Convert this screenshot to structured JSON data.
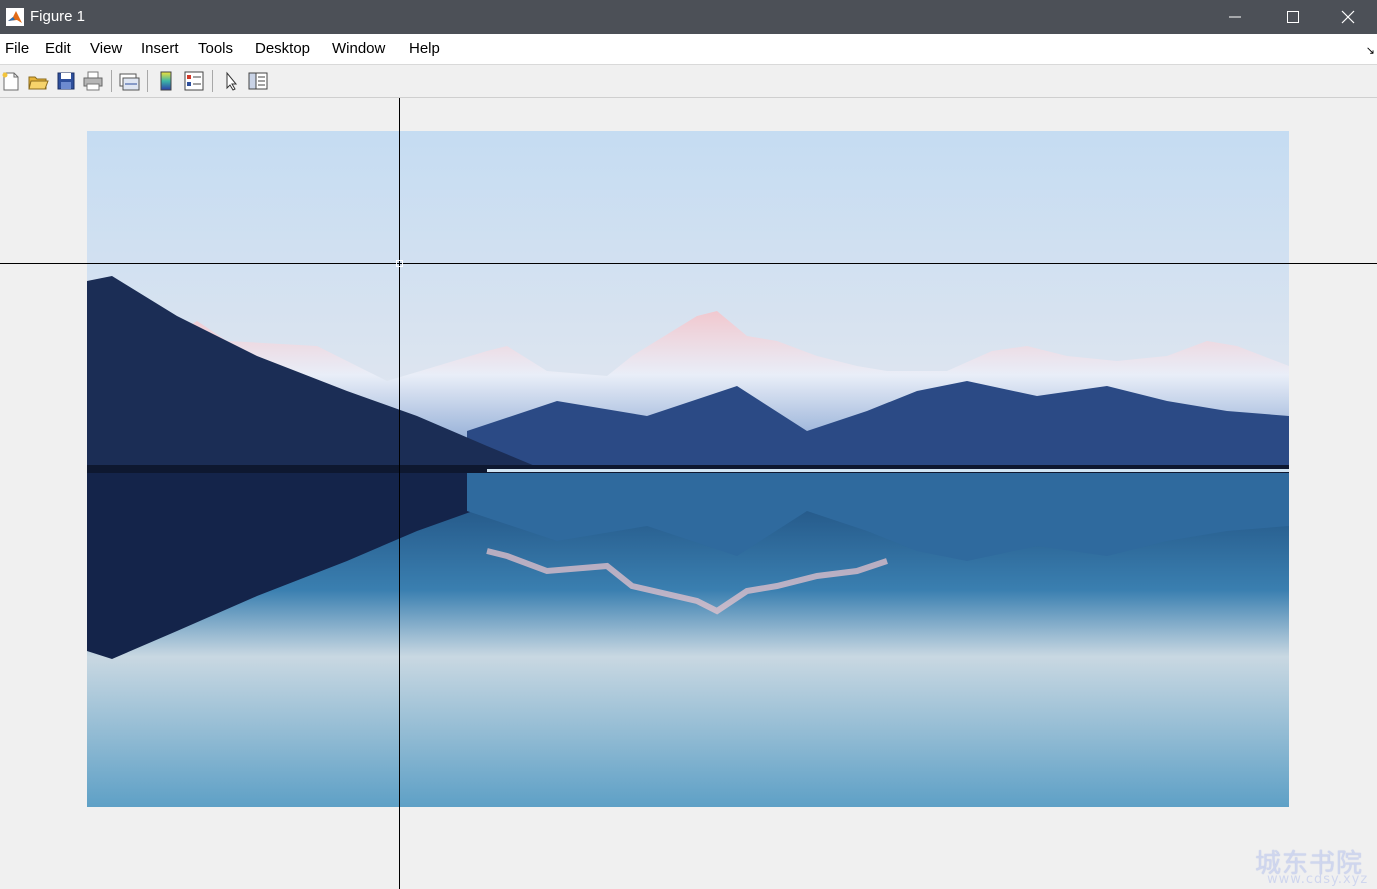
{
  "window": {
    "title": "Figure 1",
    "icon": "matlab-icon"
  },
  "menu": {
    "items": [
      "File",
      "Edit",
      "View",
      "Insert",
      "Tools",
      "Desktop",
      "Window",
      "Help"
    ],
    "dock_glyph": "↘"
  },
  "toolbar": {
    "buttons": [
      "new-figure-icon",
      "open-file-icon",
      "save-figure-icon",
      "print-figure-icon",
      "link-plot-icon",
      "insert-colorbar-icon",
      "insert-legend-icon",
      "edit-plot-icon",
      "property-inspector-icon"
    ]
  },
  "image": {
    "subject": "snow-capped mountains reflected in a calm lake at dusk",
    "colors": {
      "sky_top": "#c5dcf2",
      "sky_bottom": "#e6e8ef",
      "mountain_dark": "#1b2d55",
      "snow": "#e9eef8",
      "snow_pink": "#f1c8cf",
      "water_top": "#1d4a7a",
      "water_bottom": "#5ea0c6"
    }
  },
  "crosshair": {
    "color": "#000000"
  },
  "watermark": {
    "text": "城东书院",
    "subtext": "www.cdsy.xyz"
  }
}
